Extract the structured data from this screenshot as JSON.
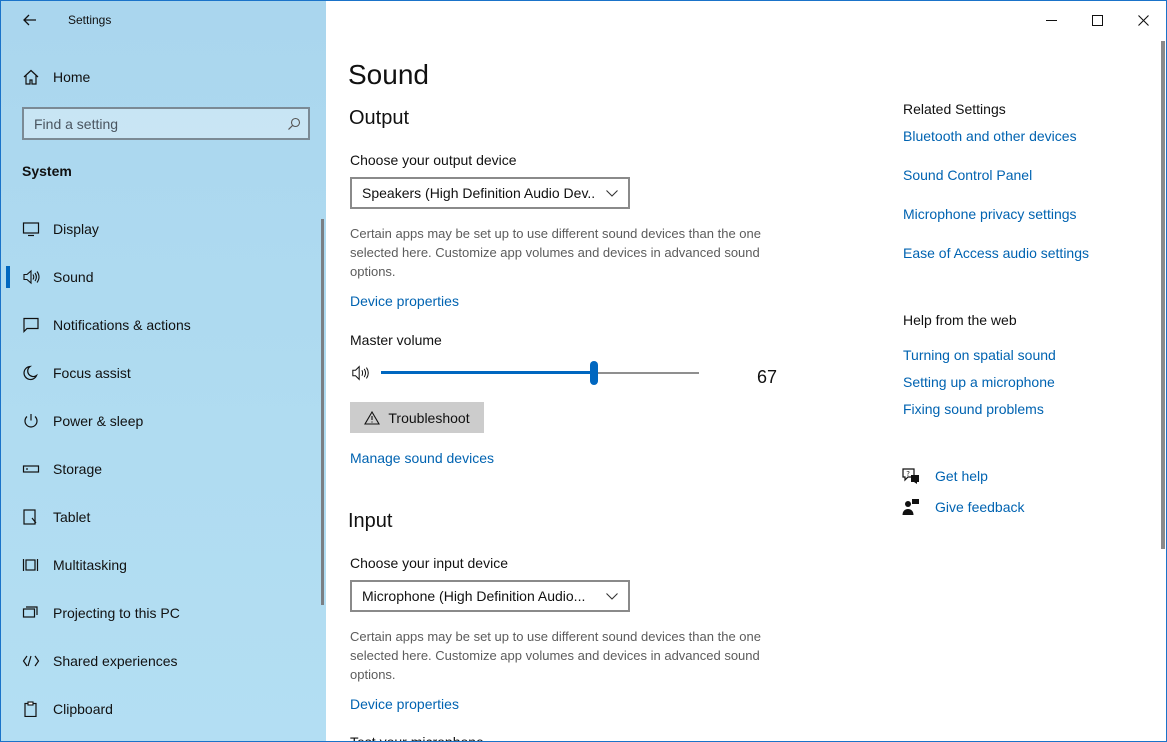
{
  "window": {
    "app_title": "Settings"
  },
  "sidebar": {
    "home_label": "Home",
    "search_placeholder": "Find a setting",
    "section_title": "System",
    "items": [
      {
        "label": "Display",
        "icon": "display-icon"
      },
      {
        "label": "Sound",
        "icon": "speaker-icon",
        "active": true
      },
      {
        "label": "Notifications & actions",
        "icon": "notification-icon"
      },
      {
        "label": "Focus assist",
        "icon": "moon-icon"
      },
      {
        "label": "Power & sleep",
        "icon": "power-icon"
      },
      {
        "label": "Storage",
        "icon": "storage-icon"
      },
      {
        "label": "Tablet",
        "icon": "tablet-icon"
      },
      {
        "label": "Multitasking",
        "icon": "multitasking-icon"
      },
      {
        "label": "Projecting to this PC",
        "icon": "projecting-icon"
      },
      {
        "label": "Shared experiences",
        "icon": "shared-icon"
      },
      {
        "label": "Clipboard",
        "icon": "clipboard-icon"
      }
    ]
  },
  "main": {
    "page_title": "Sound",
    "output": {
      "heading": "Output",
      "device_label": "Choose your output device",
      "device_value": "Speakers (High Definition Audio Dev...",
      "description": "Certain apps may be set up to use different sound devices than the one selected here. Customize app volumes and devices in advanced sound options.",
      "device_properties_link": "Device properties",
      "master_volume_label": "Master volume",
      "volume": 67,
      "volume_text": "67",
      "troubleshoot_label": "Troubleshoot",
      "manage_link": "Manage sound devices"
    },
    "input": {
      "heading": "Input",
      "device_label": "Choose your input device",
      "device_value": "Microphone (High Definition Audio...",
      "description": "Certain apps may be set up to use different sound devices than the one selected here. Customize app volumes and devices in advanced sound options.",
      "device_properties_link": "Device properties",
      "partial_label": "Test your microphone"
    }
  },
  "related": {
    "heading": "Related Settings",
    "links": [
      "Bluetooth and other devices",
      "Sound Control Panel",
      "Microphone privacy settings",
      "Ease of Access audio settings"
    ]
  },
  "help": {
    "heading": "Help from the web",
    "links": [
      "Turning on spatial sound",
      "Setting up a microphone",
      "Fixing sound problems"
    ],
    "get_help": "Get help",
    "give_feedback": "Give feedback"
  },
  "colors": {
    "accent": "#0067c0",
    "link": "#0063b1",
    "sidebar": "#aed9ef"
  }
}
